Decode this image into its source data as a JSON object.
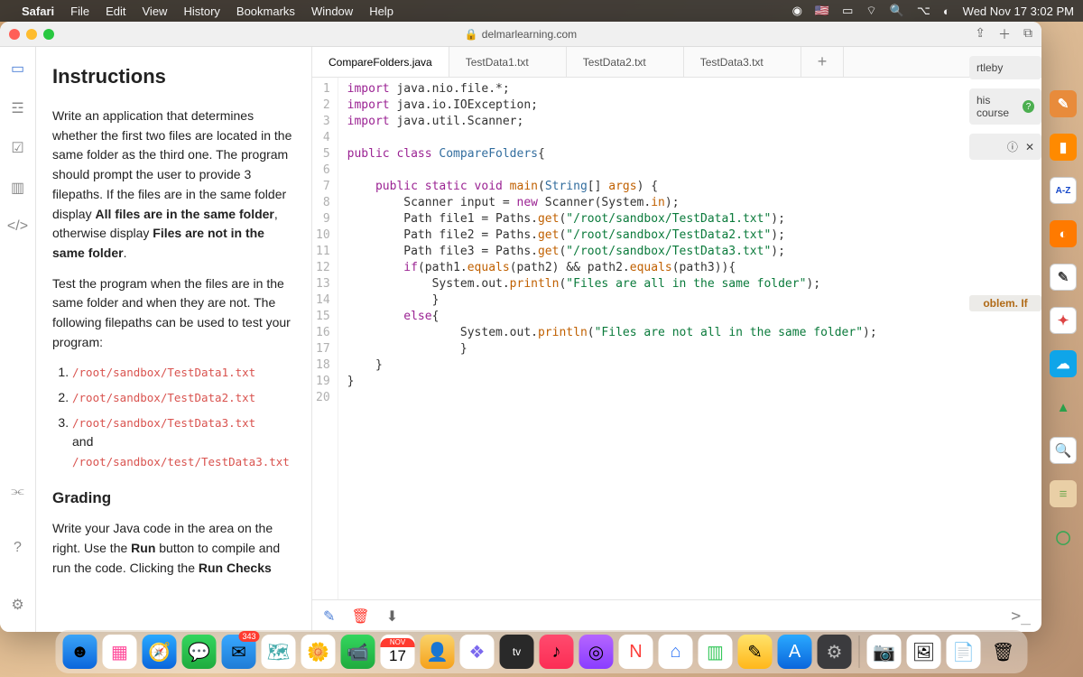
{
  "menubar": {
    "app": "Safari",
    "items": [
      "File",
      "Edit",
      "View",
      "History",
      "Bookmarks",
      "Window",
      "Help"
    ],
    "datetime": "Wed Nov 17  3:02 PM"
  },
  "browser": {
    "url_host": "delmarlearning.com"
  },
  "instructions": {
    "heading": "Instructions",
    "p1a": "Write an application that determines whether the first two files are located in the same folder as the third one. The program should prompt the user to provide 3 filepaths. If the files are in the same folder display ",
    "p1b": "All files are in the same folder",
    "p1c": ", otherwise display ",
    "p1d": "Files are not in the same folder",
    "p1e": ".",
    "p2": "Test the program when the files are in the same folder and when they are not. The following filepaths can be used to test your program:",
    "fp1": "/root/sandbox/TestData1.txt",
    "fp2": "/root/sandbox/TestData2.txt",
    "fp3": "/root/sandbox/TestData3.txt",
    "and": "and",
    "fp4": "/root/sandbox/test/TestData3.txt",
    "grading_h": "Grading",
    "grading_p_a": "Write your Java code in the area on the right. Use the ",
    "grading_p_b": "Run",
    "grading_p_c": " button to compile and run the code. Clicking the ",
    "grading_p_d": "Run Checks"
  },
  "editor": {
    "tabs": [
      "CompareFolders.java",
      "TestData1.txt",
      "TestData2.txt",
      "TestData3.txt"
    ],
    "lines": 20
  },
  "code": {
    "l1": {
      "a": "import",
      "b": " java.nio.file.*;"
    },
    "l2": {
      "a": "import",
      "b": " java.io.IOException;"
    },
    "l3": {
      "a": "import",
      "b": " java.util.Scanner;"
    },
    "l5": {
      "a": "public class ",
      "b": "CompareFolders",
      "c": "{"
    },
    "l7": {
      "a": "    public static void ",
      "b": "main",
      "c": "(",
      "d": "String",
      "e": "[] ",
      "f": "args",
      "g": ") {"
    },
    "l8": {
      "a": "        Scanner input = ",
      "b": "new",
      "c": " Scanner(System.",
      "d": "in",
      "e": ");"
    },
    "l9": {
      "a": "        Path file1 = Paths.",
      "b": "get",
      "c": "(",
      "d": "\"/root/sandbox/TestData1.txt\"",
      "e": ");"
    },
    "l10": {
      "a": "        Path file2 = Paths.",
      "b": "get",
      "c": "(",
      "d": "\"/root/sandbox/TestData2.txt\"",
      "e": ");"
    },
    "l11": {
      "a": "        Path file3 = Paths.",
      "b": "get",
      "c": "(",
      "d": "\"/root/sandbox/TestData3.txt\"",
      "e": ");"
    },
    "l12": {
      "a": "        if",
      "b": "(path1.",
      "c": "equals",
      "d": "(path2) && path2.",
      "e": "equals",
      "f": "(path3)){"
    },
    "l13": {
      "a": "            System.out.",
      "b": "println",
      "c": "(",
      "d": "\"Files are all in the same folder\"",
      "e": ");"
    },
    "l14": "            }",
    "l15": {
      "a": "        else",
      "b": "{"
    },
    "l16": {
      "a": "                System.out.",
      "b": "println",
      "c": "(",
      "d": "\"Files are not all in the same folder\"",
      "e": ");"
    },
    "l17": "                }",
    "l18": "    }",
    "l19": "}"
  },
  "right_peek": {
    "t1": "rtleby",
    "t2": "his course",
    "t3": "oblem. If"
  },
  "calendar": {
    "month": "NOV",
    "day": "17"
  },
  "mail_badge": "343",
  "right_icons": [
    {
      "bg": "#e88b3b",
      "glyph": "✎"
    },
    {
      "bg": "#ff8a00",
      "glyph": "▮"
    },
    {
      "bg": "#fff",
      "glyph": "A-Z",
      "fg": "#1447c9",
      "border": "1px solid #ccc",
      "fs": "10px"
    },
    {
      "bg": "#ff7a00",
      "glyph": "◐"
    },
    {
      "bg": "#fff",
      "glyph": "✎",
      "fg": "#444",
      "border": "1px solid #ccc"
    },
    {
      "bg": "#fff",
      "glyph": "✦",
      "fg": "#d44",
      "border": "1px solid #ccc"
    },
    {
      "bg": "#0fa5e9",
      "glyph": "☁"
    },
    {
      "bg": "transparent",
      "glyph": "▲",
      "fg": "#2aa04a"
    },
    {
      "bg": "#fff",
      "glyph": "🔍",
      "fg": "#333",
      "border": "1px solid #ccc"
    },
    {
      "bg": "#e9cfa6",
      "glyph": "≡",
      "fg": "#7a5"
    },
    {
      "bg": "transparent",
      "glyph": "◯",
      "fg": "#3aa655"
    }
  ],
  "dock_apps": [
    {
      "bg": "linear-gradient(#3ba4f7,#0a66dc)",
      "glyph": "☻"
    },
    {
      "bg": "#fff",
      "glyph": "▦",
      "fg": "#ff4b9b"
    },
    {
      "bg": "linear-gradient(#2aa9ff,#0a66dc)",
      "glyph": "🧭"
    },
    {
      "bg": "linear-gradient(#34d65e,#1fab3e)",
      "glyph": "💬"
    },
    {
      "bg": "linear-gradient(#38a8ff,#1f7cd6)",
      "glyph": "✉",
      "badge": "343"
    },
    {
      "bg": "#fff",
      "glyph": "🗺",
      "fg": "#4aa"
    },
    {
      "bg": "#fff",
      "glyph": "🌼",
      "fg": "#f7c"
    },
    {
      "bg": "linear-gradient(#34d65e,#1fab3e)",
      "glyph": "📹"
    },
    {
      "bg": "#fff",
      "glyph": "📅",
      "calendar": true
    },
    {
      "bg": "linear-gradient(#f9d36b,#f6a11a)",
      "glyph": "👤"
    },
    {
      "bg": "#fff",
      "glyph": "❖",
      "fg": "#7b68ee"
    },
    {
      "bg": "#292929",
      "glyph": "tv",
      "fg": "#fff",
      "fs": "12px"
    },
    {
      "bg": "linear-gradient(#ff4b6e,#fc2d55)",
      "glyph": "♪"
    },
    {
      "bg": "linear-gradient(#b565ff,#8a3dff)",
      "glyph": "◎"
    },
    {
      "bg": "#fff",
      "glyph": "N",
      "fg": "#fc3d39"
    },
    {
      "bg": "#fff",
      "glyph": "⌂",
      "fg": "#3478f6"
    },
    {
      "bg": "#fff",
      "glyph": "▥",
      "fg": "#34c759"
    },
    {
      "bg": "linear-gradient(#ffe36b,#ffb71a)",
      "glyph": "✎"
    },
    {
      "bg": "linear-gradient(#2aa9ff,#0a66dc)",
      "glyph": "A",
      "fg": "#fff"
    },
    {
      "bg": "#3b3b3e",
      "glyph": "⚙",
      "fg": "#bbb"
    }
  ],
  "dock_right": [
    {
      "bg": "#fff",
      "glyph": "📷"
    },
    {
      "bg": "#fff",
      "glyph": "🖼"
    },
    {
      "bg": "#fff",
      "glyph": "📄"
    },
    {
      "bg": "transparent",
      "glyph": "🗑"
    }
  ]
}
